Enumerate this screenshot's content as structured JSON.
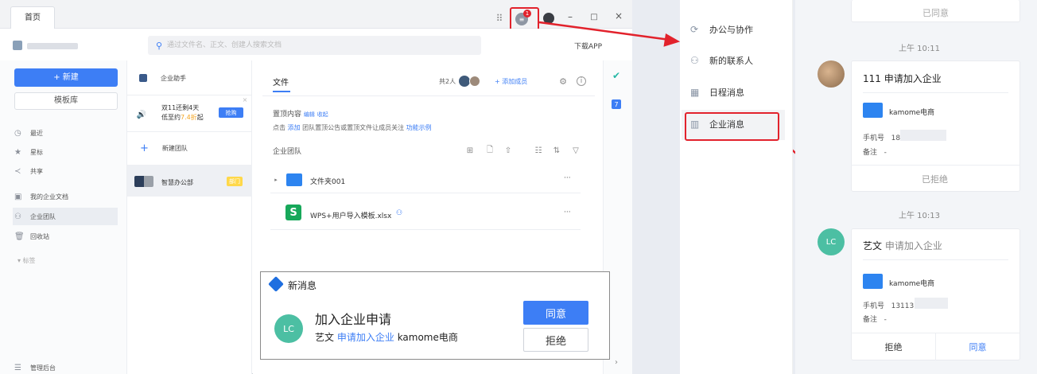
{
  "app": {
    "tab": "首页",
    "download": "下载APP",
    "search_placeholder": "通过文件名、正文、创建人搜索文档",
    "badge": "1"
  },
  "sidebar": {
    "new": "+ 新建",
    "template": "模板库",
    "items": [
      {
        "icon": "clock-icon",
        "label": "最近"
      },
      {
        "icon": "star-icon",
        "label": "星标"
      },
      {
        "icon": "share-icon",
        "label": "共享"
      },
      {
        "icon": "doc-icon",
        "label": "我的企业文档"
      },
      {
        "icon": "team-icon",
        "label": "企业团队"
      },
      {
        "icon": "trash-icon",
        "label": "回收站"
      }
    ],
    "tags": "▾ 标签",
    "admin": "管理后台"
  },
  "mid": {
    "helper": "企业助手",
    "promo_line1": "双11还剩4天",
    "promo_line2a": "低至约",
    "promo_line2b": "7.4折",
    "promo_line2c": "起",
    "promo_btn": "抢购",
    "new_team": "新建团队",
    "office": "智慧办公部",
    "office_badge": "部门"
  },
  "content": {
    "tab": "文件",
    "members": "共2人",
    "add_member": "添加成员",
    "pinned": "置顶内容",
    "edit": "编辑",
    "collapse": "收起",
    "hint_a": "点击 ",
    "hint_add": "添加",
    "hint_b": " 团队置顶公告或置顶文件让成员关注 ",
    "hint_example": "功能示例",
    "group": "企业团队",
    "files": [
      {
        "name": "文件夹001",
        "type": "folder"
      },
      {
        "name": "WPS+用户导入模板.xlsx",
        "type": "sheet"
      }
    ],
    "more": "···"
  },
  "popup": {
    "title": "新消息",
    "heading": "加入企业申请",
    "avatar": "LC",
    "name": "艺文",
    "action": "申请加入企业",
    "company": "kamome电商",
    "agree": "同意",
    "reject": "拒绝"
  },
  "right_nav": [
    {
      "icon": "cooperation-icon",
      "label": "办公与协作"
    },
    {
      "icon": "contacts-icon",
      "label": "新的联系人"
    },
    {
      "icon": "calendar-icon",
      "label": "日程消息"
    },
    {
      "icon": "enterprise-icon",
      "label": "企业消息"
    }
  ],
  "right_chat": {
    "top_status": "已同意",
    "time1": "上午 10:11",
    "req1": "111 申请加入企业",
    "company": "kamome电商",
    "phone_label": "手机号",
    "phone1": "185",
    "note_label": "备注",
    "note": "-",
    "status1": "已拒绝",
    "time2": "上午 10:13",
    "avatar2": "LC",
    "req2_name": "艺文",
    "req2_action": " 申请加入企业",
    "phone2": "13113",
    "reject": "拒绝",
    "agree": "同意"
  },
  "colors": {
    "accent": "#3d7ef5",
    "red": "#e2222c",
    "orange": "#f5a623"
  }
}
